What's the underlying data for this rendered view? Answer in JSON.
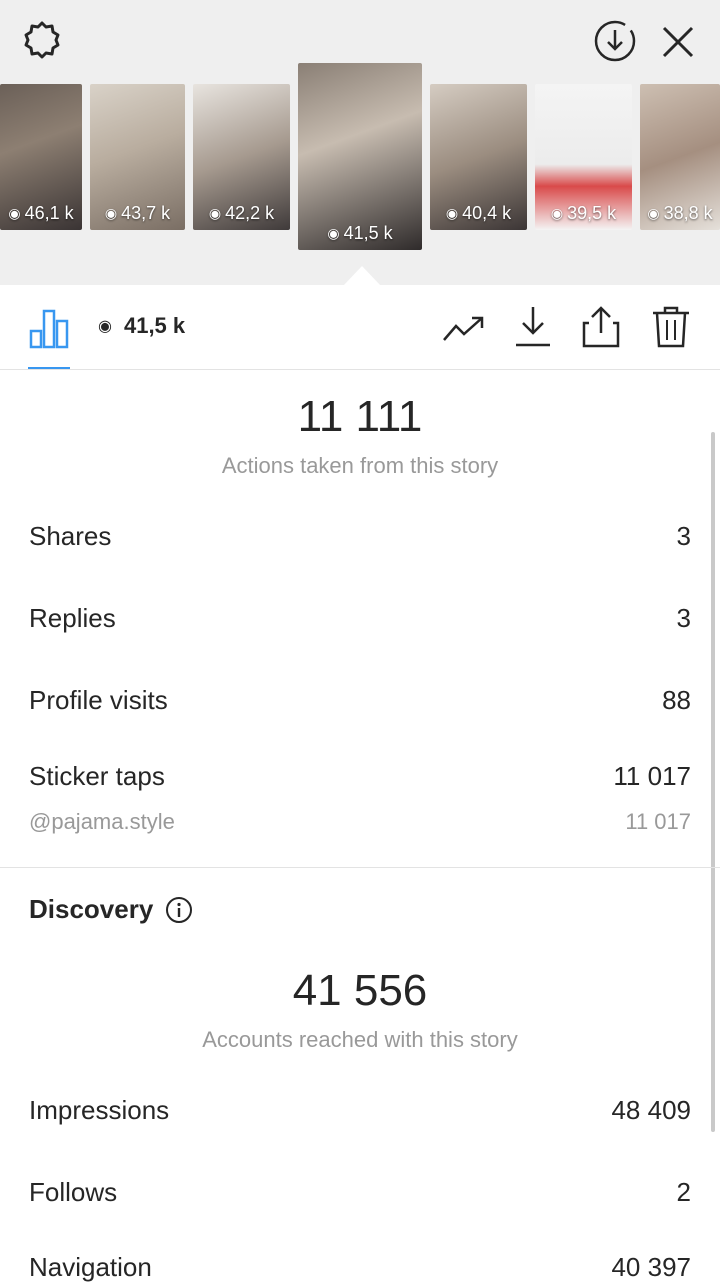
{
  "stories": [
    {
      "views": "46,1 k"
    },
    {
      "views": "43,7 k"
    },
    {
      "views": "42,2 k"
    },
    {
      "views": "41,5 k"
    },
    {
      "views": "40,4 k"
    },
    {
      "views": "39,5 k"
    },
    {
      "views": "38,8 k"
    }
  ],
  "toolbar": {
    "views_total": "41,5 k"
  },
  "interactions": {
    "total": "11 111",
    "caption": "Actions taken from this story",
    "rows": [
      {
        "label": "Shares",
        "value": "3"
      },
      {
        "label": "Replies",
        "value": "3"
      },
      {
        "label": "Profile visits",
        "value": "88"
      },
      {
        "label": "Sticker taps",
        "value": "11 017"
      }
    ],
    "sticker_handle": "@pajama.style",
    "sticker_handle_value": "11 017"
  },
  "discovery": {
    "title": "Discovery",
    "total": "41 556",
    "caption": "Accounts reached with this story",
    "rows": [
      {
        "label": "Impressions",
        "value": "48 409"
      },
      {
        "label": "Follows",
        "value": "2"
      },
      {
        "label": "Navigation",
        "value": "40 397"
      }
    ]
  },
  "colors": {
    "accent": "#3897f0",
    "text": "#262626",
    "muted": "#999999",
    "top_bg": "#efefef"
  }
}
